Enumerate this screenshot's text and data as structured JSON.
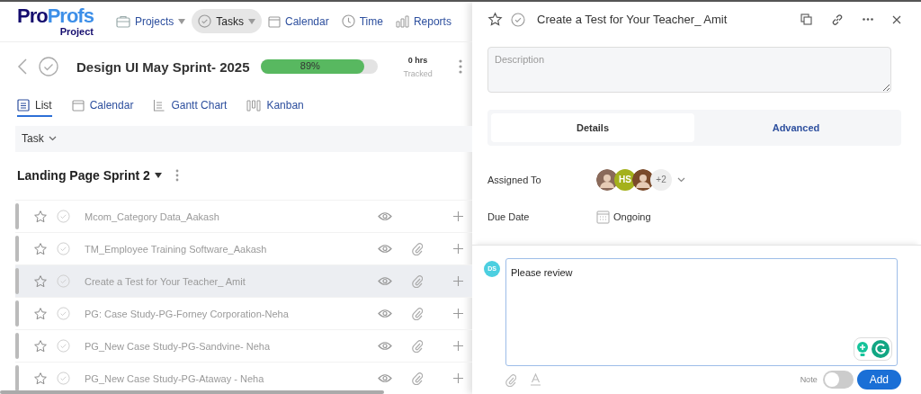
{
  "logo": {
    "brand_a": "Pro",
    "brand_b": "Profs",
    "product": "Project"
  },
  "nav": [
    {
      "label": "Projects",
      "dropdown": true,
      "selected": false
    },
    {
      "label": "Tasks",
      "dropdown": true,
      "selected": true
    },
    {
      "label": "Calendar",
      "dropdown": false,
      "selected": false
    },
    {
      "label": "Time",
      "dropdown": false,
      "selected": false
    },
    {
      "label": "Reports",
      "dropdown": false,
      "selected": false
    }
  ],
  "project": {
    "title": "Design UI May Sprint- 2025",
    "progress_label": "89%",
    "level": 0.89,
    "hours": "0 hrs",
    "hours_caption": "Tracked"
  },
  "views": [
    {
      "label": "List",
      "selected": true
    },
    {
      "label": "Calendar",
      "selected": false
    },
    {
      "label": "Gantt Chart",
      "selected": false
    },
    {
      "label": "Kanban",
      "selected": false
    }
  ],
  "table_header": {
    "label": "Task"
  },
  "group": {
    "title": "Landing Page Sprint 2"
  },
  "rows": [
    {
      "name": "Mcom_Category Data_Aakash",
      "attachment": false,
      "selected": false
    },
    {
      "name": "TM_Employee Training Software_Aakash",
      "attachment": true,
      "selected": false
    },
    {
      "name": "Create a Test for Your Teacher_ Amit",
      "attachment": true,
      "selected": true
    },
    {
      "name": "PG: Case Study-PG-Forney Corporation-Neha",
      "attachment": true,
      "selected": false
    },
    {
      "name": "PG_New Case Study-PG-Sandvine- Neha",
      "attachment": true,
      "selected": false
    },
    {
      "name": "PG_New Case Study-PG-Ataway - Neha",
      "attachment": true,
      "selected": false
    }
  ],
  "drawer": {
    "title": "Create a Test for Your Teacher_ Amit",
    "description": {
      "placeholder": "Description"
    },
    "tabs": [
      {
        "label": "Details",
        "selected": true
      },
      {
        "label": "Advanced",
        "selected": false
      }
    ],
    "assigned_label": "Assigned To",
    "assignees": [
      {
        "kind": "photo",
        "color": "#8a6a5a"
      },
      {
        "kind": "initials",
        "initials": "HS",
        "color": "#a4b11c"
      },
      {
        "kind": "photo",
        "color": "#7a4a2a"
      },
      {
        "kind": "more",
        "initials": "+2",
        "color": "#eeeeee"
      }
    ],
    "due_label": "Due Date",
    "due_value": "Ongoing"
  },
  "comment": {
    "avatar": "DS",
    "value": "Please review",
    "note_label": "Note",
    "note_on": false,
    "add": "Add"
  }
}
